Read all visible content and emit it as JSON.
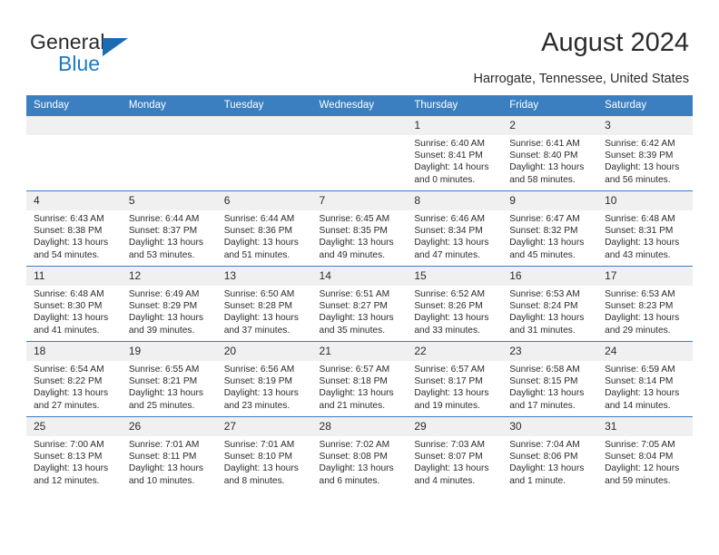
{
  "brand": {
    "name_top": "General",
    "name_bottom": "Blue"
  },
  "header": {
    "title": "August 2024",
    "subtitle": "Harrogate, Tennessee, United States"
  },
  "colors": {
    "header_blue": "#3b7fc0",
    "logo_blue": "#1e7ac4",
    "daynum_bg": "#f0f0f0",
    "text": "#2b2b2b"
  },
  "calendar": {
    "weekday_headers": [
      "Sunday",
      "Monday",
      "Tuesday",
      "Wednesday",
      "Thursday",
      "Friday",
      "Saturday"
    ],
    "weeks": [
      [
        {
          "day": "",
          "sunrise": "",
          "sunset": "",
          "daylight_1": "",
          "daylight_2": "",
          "empty": true
        },
        {
          "day": "",
          "sunrise": "",
          "sunset": "",
          "daylight_1": "",
          "daylight_2": "",
          "empty": true
        },
        {
          "day": "",
          "sunrise": "",
          "sunset": "",
          "daylight_1": "",
          "daylight_2": "",
          "empty": true
        },
        {
          "day": "",
          "sunrise": "",
          "sunset": "",
          "daylight_1": "",
          "daylight_2": "",
          "empty": true
        },
        {
          "day": "1",
          "sunrise": "Sunrise: 6:40 AM",
          "sunset": "Sunset: 8:41 PM",
          "daylight_1": "Daylight: 14 hours",
          "daylight_2": "and 0 minutes."
        },
        {
          "day": "2",
          "sunrise": "Sunrise: 6:41 AM",
          "sunset": "Sunset: 8:40 PM",
          "daylight_1": "Daylight: 13 hours",
          "daylight_2": "and 58 minutes."
        },
        {
          "day": "3",
          "sunrise": "Sunrise: 6:42 AM",
          "sunset": "Sunset: 8:39 PM",
          "daylight_1": "Daylight: 13 hours",
          "daylight_2": "and 56 minutes."
        }
      ],
      [
        {
          "day": "4",
          "sunrise": "Sunrise: 6:43 AM",
          "sunset": "Sunset: 8:38 PM",
          "daylight_1": "Daylight: 13 hours",
          "daylight_2": "and 54 minutes."
        },
        {
          "day": "5",
          "sunrise": "Sunrise: 6:44 AM",
          "sunset": "Sunset: 8:37 PM",
          "daylight_1": "Daylight: 13 hours",
          "daylight_2": "and 53 minutes."
        },
        {
          "day": "6",
          "sunrise": "Sunrise: 6:44 AM",
          "sunset": "Sunset: 8:36 PM",
          "daylight_1": "Daylight: 13 hours",
          "daylight_2": "and 51 minutes."
        },
        {
          "day": "7",
          "sunrise": "Sunrise: 6:45 AM",
          "sunset": "Sunset: 8:35 PM",
          "daylight_1": "Daylight: 13 hours",
          "daylight_2": "and 49 minutes."
        },
        {
          "day": "8",
          "sunrise": "Sunrise: 6:46 AM",
          "sunset": "Sunset: 8:34 PM",
          "daylight_1": "Daylight: 13 hours",
          "daylight_2": "and 47 minutes."
        },
        {
          "day": "9",
          "sunrise": "Sunrise: 6:47 AM",
          "sunset": "Sunset: 8:32 PM",
          "daylight_1": "Daylight: 13 hours",
          "daylight_2": "and 45 minutes."
        },
        {
          "day": "10",
          "sunrise": "Sunrise: 6:48 AM",
          "sunset": "Sunset: 8:31 PM",
          "daylight_1": "Daylight: 13 hours",
          "daylight_2": "and 43 minutes."
        }
      ],
      [
        {
          "day": "11",
          "sunrise": "Sunrise: 6:48 AM",
          "sunset": "Sunset: 8:30 PM",
          "daylight_1": "Daylight: 13 hours",
          "daylight_2": "and 41 minutes."
        },
        {
          "day": "12",
          "sunrise": "Sunrise: 6:49 AM",
          "sunset": "Sunset: 8:29 PM",
          "daylight_1": "Daylight: 13 hours",
          "daylight_2": "and 39 minutes."
        },
        {
          "day": "13",
          "sunrise": "Sunrise: 6:50 AM",
          "sunset": "Sunset: 8:28 PM",
          "daylight_1": "Daylight: 13 hours",
          "daylight_2": "and 37 minutes."
        },
        {
          "day": "14",
          "sunrise": "Sunrise: 6:51 AM",
          "sunset": "Sunset: 8:27 PM",
          "daylight_1": "Daylight: 13 hours",
          "daylight_2": "and 35 minutes."
        },
        {
          "day": "15",
          "sunrise": "Sunrise: 6:52 AM",
          "sunset": "Sunset: 8:26 PM",
          "daylight_1": "Daylight: 13 hours",
          "daylight_2": "and 33 minutes."
        },
        {
          "day": "16",
          "sunrise": "Sunrise: 6:53 AM",
          "sunset": "Sunset: 8:24 PM",
          "daylight_1": "Daylight: 13 hours",
          "daylight_2": "and 31 minutes."
        },
        {
          "day": "17",
          "sunrise": "Sunrise: 6:53 AM",
          "sunset": "Sunset: 8:23 PM",
          "daylight_1": "Daylight: 13 hours",
          "daylight_2": "and 29 minutes."
        }
      ],
      [
        {
          "day": "18",
          "sunrise": "Sunrise: 6:54 AM",
          "sunset": "Sunset: 8:22 PM",
          "daylight_1": "Daylight: 13 hours",
          "daylight_2": "and 27 minutes."
        },
        {
          "day": "19",
          "sunrise": "Sunrise: 6:55 AM",
          "sunset": "Sunset: 8:21 PM",
          "daylight_1": "Daylight: 13 hours",
          "daylight_2": "and 25 minutes."
        },
        {
          "day": "20",
          "sunrise": "Sunrise: 6:56 AM",
          "sunset": "Sunset: 8:19 PM",
          "daylight_1": "Daylight: 13 hours",
          "daylight_2": "and 23 minutes."
        },
        {
          "day": "21",
          "sunrise": "Sunrise: 6:57 AM",
          "sunset": "Sunset: 8:18 PM",
          "daylight_1": "Daylight: 13 hours",
          "daylight_2": "and 21 minutes."
        },
        {
          "day": "22",
          "sunrise": "Sunrise: 6:57 AM",
          "sunset": "Sunset: 8:17 PM",
          "daylight_1": "Daylight: 13 hours",
          "daylight_2": "and 19 minutes."
        },
        {
          "day": "23",
          "sunrise": "Sunrise: 6:58 AM",
          "sunset": "Sunset: 8:15 PM",
          "daylight_1": "Daylight: 13 hours",
          "daylight_2": "and 17 minutes."
        },
        {
          "day": "24",
          "sunrise": "Sunrise: 6:59 AM",
          "sunset": "Sunset: 8:14 PM",
          "daylight_1": "Daylight: 13 hours",
          "daylight_2": "and 14 minutes."
        }
      ],
      [
        {
          "day": "25",
          "sunrise": "Sunrise: 7:00 AM",
          "sunset": "Sunset: 8:13 PM",
          "daylight_1": "Daylight: 13 hours",
          "daylight_2": "and 12 minutes."
        },
        {
          "day": "26",
          "sunrise": "Sunrise: 7:01 AM",
          "sunset": "Sunset: 8:11 PM",
          "daylight_1": "Daylight: 13 hours",
          "daylight_2": "and 10 minutes."
        },
        {
          "day": "27",
          "sunrise": "Sunrise: 7:01 AM",
          "sunset": "Sunset: 8:10 PM",
          "daylight_1": "Daylight: 13 hours",
          "daylight_2": "and 8 minutes."
        },
        {
          "day": "28",
          "sunrise": "Sunrise: 7:02 AM",
          "sunset": "Sunset: 8:08 PM",
          "daylight_1": "Daylight: 13 hours",
          "daylight_2": "and 6 minutes."
        },
        {
          "day": "29",
          "sunrise": "Sunrise: 7:03 AM",
          "sunset": "Sunset: 8:07 PM",
          "daylight_1": "Daylight: 13 hours",
          "daylight_2": "and 4 minutes."
        },
        {
          "day": "30",
          "sunrise": "Sunrise: 7:04 AM",
          "sunset": "Sunset: 8:06 PM",
          "daylight_1": "Daylight: 13 hours",
          "daylight_2": "and 1 minute."
        },
        {
          "day": "31",
          "sunrise": "Sunrise: 7:05 AM",
          "sunset": "Sunset: 8:04 PM",
          "daylight_1": "Daylight: 12 hours",
          "daylight_2": "and 59 minutes."
        }
      ]
    ]
  }
}
